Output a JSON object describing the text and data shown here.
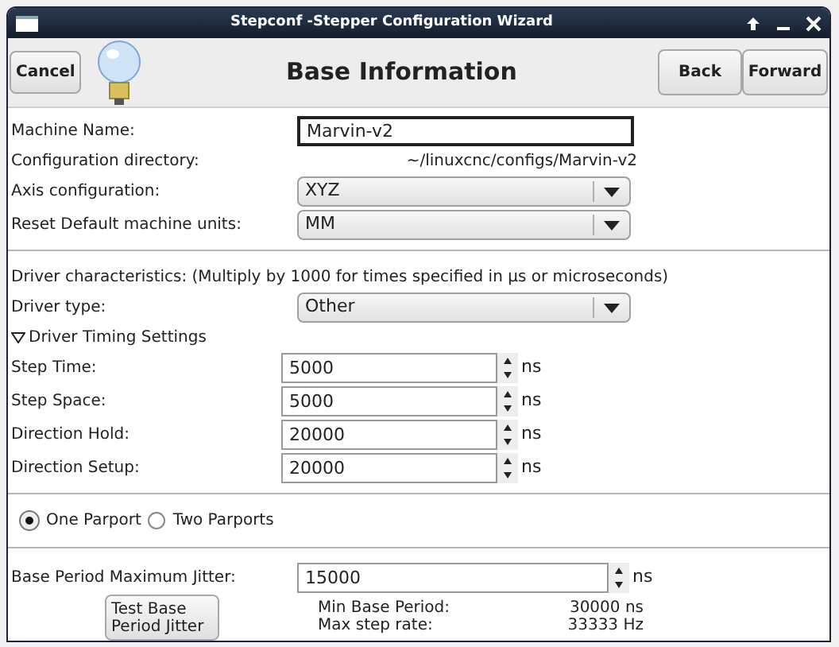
{
  "window": {
    "title": "Stepconf -Stepper Configuration Wizard"
  },
  "header": {
    "cancel": "Cancel",
    "title": "Base Information",
    "back": "Back",
    "forward": "Forward"
  },
  "machine_name": {
    "label": "Machine Name:",
    "value": "Marvin-v2"
  },
  "config_dir": {
    "label": "Configuration directory:",
    "value": "~/linuxcnc/configs/Marvin-v2"
  },
  "selects": [
    {
      "label": "Axis configuration:",
      "value": "XYZ"
    },
    {
      "label": "Reset Default machine units:",
      "value": "MM"
    }
  ],
  "driver": {
    "note": "Driver characteristics: (Multiply by 1000 for times specified in µs or microseconds)",
    "type_label": "Driver type:",
    "type_value": "Other"
  },
  "timing": {
    "label": "Driver Timing Settings",
    "expanded": true,
    "fields": [
      {
        "label": "Step Time:",
        "value": "5000",
        "unit": "ns"
      },
      {
        "label": "Step Space:",
        "value": "5000",
        "unit": "ns"
      },
      {
        "label": "Direction Hold:",
        "value": "20000",
        "unit": "ns"
      },
      {
        "label": "Direction Setup:",
        "value": "20000",
        "unit": "ns"
      }
    ]
  },
  "parports": [
    {
      "label": "One Parport",
      "selected": true
    },
    {
      "label": "Two Parports",
      "selected": false
    }
  ],
  "jitter": {
    "label": "Base Period Maximum Jitter:",
    "value": "15000",
    "unit": "ns",
    "test_button": "Test Base Period Jitter"
  },
  "results": [
    {
      "label": "Min Base Period:",
      "value": "30000 ns"
    },
    {
      "label": "Max step rate:",
      "value": "33333 Hz"
    }
  ]
}
